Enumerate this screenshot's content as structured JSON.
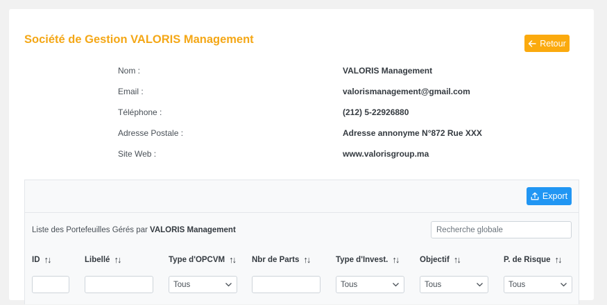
{
  "header": {
    "title": "Société de Gestion VALORIS Management",
    "back_label": "Retour"
  },
  "info": [
    {
      "label": "Nom :",
      "value": "VALORIS Management"
    },
    {
      "label": "Email :",
      "value": "valorismanagement@gmail.com"
    },
    {
      "label": "Téléphone :",
      "value": "(212) 5-22926880"
    },
    {
      "label": "Adresse Postale :",
      "value": "Adresse annonyme N°872 Rue XXX"
    },
    {
      "label": "Site Web :",
      "value": "www.valorisgroup.ma"
    }
  ],
  "table": {
    "export_label": "Export",
    "caption_prefix": "Liste des Portefeuilles Gérés par ",
    "caption_company": "VALORIS Management",
    "search_placeholder": "Recherche globale",
    "sort_icon": "sort-icon",
    "columns": [
      {
        "label": "ID",
        "filter": "input"
      },
      {
        "label": "Libellé",
        "filter": "input"
      },
      {
        "label": "Type d'OPCVM",
        "filter": "select",
        "selected": "Tous"
      },
      {
        "label": "Nbr de Parts",
        "filter": "input"
      },
      {
        "label": "Type d'Invest.",
        "filter": "select",
        "selected": "Tous"
      },
      {
        "label": "Objectif",
        "filter": "select",
        "selected": "Tous"
      },
      {
        "label": "P. de Risque",
        "filter": "select",
        "selected": "Tous"
      }
    ]
  },
  "colors": {
    "accent": "#f4a716",
    "back_button": "#fbaa0e",
    "export_button": "#2196f3"
  }
}
